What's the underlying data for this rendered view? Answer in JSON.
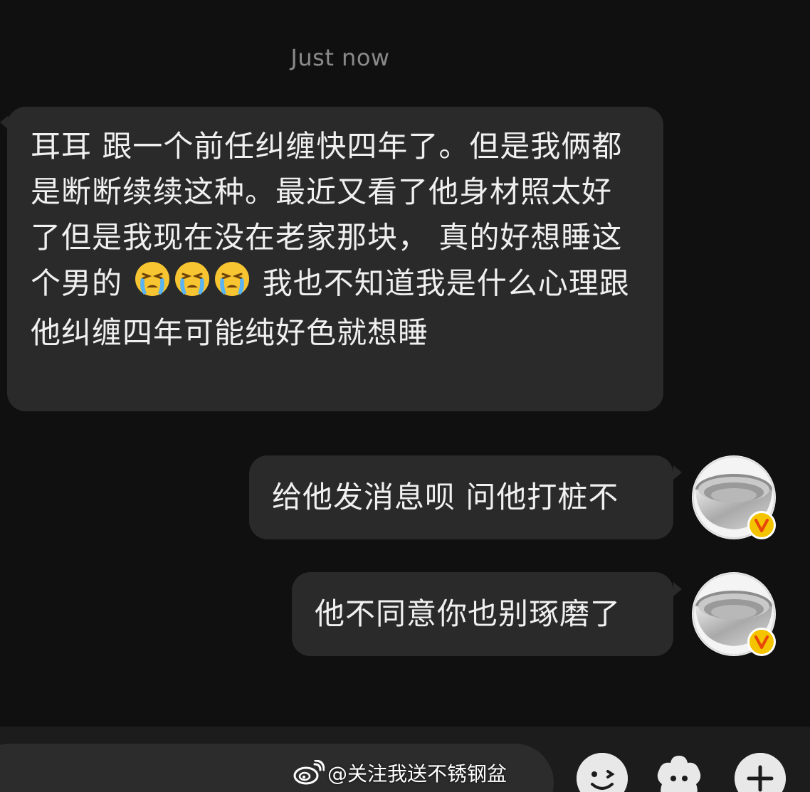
{
  "chat": {
    "timestamp": "Just now",
    "incoming_message": {
      "text_part1": "耳耳 跟一个前任纠缠快四年了。但是我俩都是断断续续这种。最近又看了他身材照太好了但是我现在没在老家那块， 真的好想睡这个男的",
      "emojis": [
        "crying-face",
        "crying-face",
        "crying-face"
      ],
      "text_part2": " 我也不知道我是什么心理跟他纠缠四年可能纯好色就想睡"
    },
    "outgoing_messages": [
      {
        "text": "给他发消息呗 问他打桩不"
      },
      {
        "text": "他不同意你也别琢磨了"
      }
    ],
    "avatar": {
      "icon": "stainless-steel-bowl",
      "badge_color": "#f5c400",
      "badge_letter": "V"
    }
  },
  "input_bar": {
    "buttons": [
      "emoji-button",
      "sticker-button",
      "plus-button"
    ]
  },
  "watermark": {
    "text": "@关注我送不锈钢盆",
    "icon": "weibo-logo"
  },
  "colors": {
    "background": "#101010",
    "bubble": "#2a2a2a",
    "text": "#f0f0f0",
    "timestamp": "#8a8a8a"
  }
}
